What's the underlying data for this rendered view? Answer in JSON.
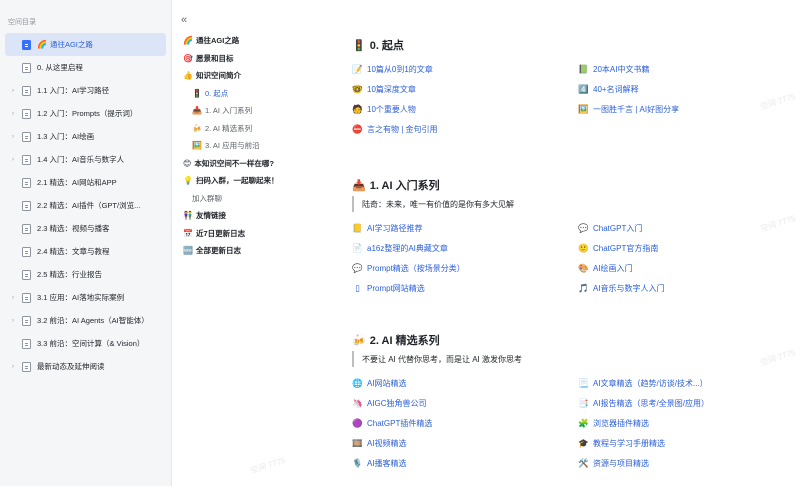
{
  "sidebar": {
    "title": "空间目录",
    "items": [
      {
        "arrow": "",
        "emoji": "🌈",
        "label": "通往AGI之路",
        "active": true
      },
      {
        "arrow": "",
        "emoji": "",
        "label": "0. 从这里启程"
      },
      {
        "arrow": "›",
        "emoji": "",
        "label": "1.1 入门：AI学习路径"
      },
      {
        "arrow": "›",
        "emoji": "",
        "label": "1.2 入门：Prompts（提示词）"
      },
      {
        "arrow": "›",
        "emoji": "",
        "label": "1.3 入门：AI绘画"
      },
      {
        "arrow": "›",
        "emoji": "",
        "label": "1.4 入门：AI音乐与数字人"
      },
      {
        "arrow": "",
        "emoji": "",
        "label": "2.1 精选：AI网站和APP"
      },
      {
        "arrow": "",
        "emoji": "",
        "label": "2.2 精选：AI插件（GPT/浏览..."
      },
      {
        "arrow": "",
        "emoji": "",
        "label": "2.3 精选：视频与播客"
      },
      {
        "arrow": "",
        "emoji": "",
        "label": "2.4 精选：文章与教程"
      },
      {
        "arrow": "",
        "emoji": "",
        "label": "2.5 精选：行业报告"
      },
      {
        "arrow": "›",
        "emoji": "",
        "label": "3.1 应用：AI落地实际案例"
      },
      {
        "arrow": "›",
        "emoji": "",
        "label": "3.2 前沿：AI Agents（AI智能体）"
      },
      {
        "arrow": "",
        "emoji": "",
        "label": "3.3 前沿：空间计算（& Vision）"
      },
      {
        "arrow": "›",
        "emoji": "",
        "label": "最新动态及延伸阅读"
      }
    ]
  },
  "outline": {
    "collapse_icon": "«",
    "items": [
      {
        "level": "l1",
        "emoji": "🌈",
        "label": "通往AGI之路"
      },
      {
        "level": "l1",
        "emoji": "🎯",
        "label": "愿景和目标"
      },
      {
        "level": "l1",
        "emoji": "👍",
        "label": "知识空间简介"
      },
      {
        "level": "l3",
        "emoji": "🚦",
        "label": "0. 起点",
        "current": true
      },
      {
        "level": "l3",
        "emoji": "📥",
        "label": "1. AI 入门系列"
      },
      {
        "level": "l3",
        "emoji": "🍻",
        "label": "2. AI 精选系列"
      },
      {
        "level": "l3",
        "emoji": "🖼️",
        "label": "3. AI 应用与前沿"
      },
      {
        "level": "l1",
        "emoji": "😊",
        "label": "本知识空间不一样在哪?"
      },
      {
        "level": "l1",
        "emoji": "💡",
        "label": "扫码入群，一起聊起来！"
      },
      {
        "level": "l2b",
        "emoji": "",
        "label": "加入群聊"
      },
      {
        "level": "l1",
        "emoji": "👫",
        "label": "友情链接"
      },
      {
        "level": "l1",
        "emoji": "📅",
        "label": "近7日更新日志"
      },
      {
        "level": "l1",
        "emoji": "🆕",
        "label": "全部更新日志"
      }
    ]
  },
  "main": {
    "sections": [
      {
        "title": "0. 起点",
        "emoji": "🚦",
        "quote": "",
        "left": [
          {
            "emoji": "📝",
            "label": "10篇从0到1的文章"
          },
          {
            "emoji": "🤓",
            "label": "10篇深度文章"
          },
          {
            "emoji": "🧑",
            "label": "10个重要人物"
          },
          {
            "emoji": "⛔",
            "label": "言之有物 | 金句引用"
          }
        ],
        "right": [
          {
            "emoji": "📗",
            "label": "20本AI中文书籍"
          },
          {
            "emoji": "4️⃣",
            "label": "40+名词解释"
          },
          {
            "emoji": "🖼️",
            "label": "一图胜千言 | AI好图分享"
          }
        ]
      },
      {
        "title": "1. AI 入门系列",
        "emoji": "📥",
        "quote": "陆奇：未来，唯一有价值的是你有多大见解",
        "left": [
          {
            "emoji": "📒",
            "label": "AI学习路径推荐"
          },
          {
            "emoji": "📄",
            "label": "a16z整理的AI典藏文章"
          },
          {
            "emoji": "💬",
            "label": "Prompt精选（按场景分类）"
          },
          {
            "emoji": "▯",
            "label": "Prompt网站精选"
          }
        ],
        "right": [
          {
            "emoji": "💬",
            "label": "ChatGPT入门"
          },
          {
            "emoji": "🙂",
            "label": "ChatGPT官方指南"
          },
          {
            "emoji": "🎨",
            "label": "AI绘画入门"
          },
          {
            "emoji": "🎵",
            "label": "AI音乐与数字人入门"
          }
        ]
      },
      {
        "title": "2. AI 精选系列",
        "emoji": "🍻",
        "quote": "不要让 AI 代替你思考，而是让 AI 激发你思考",
        "left": [
          {
            "emoji": "🌐",
            "label": "AI网站精选"
          },
          {
            "emoji": "🦄",
            "label": "AIGC独角兽公司"
          },
          {
            "emoji": "🟣",
            "label": "ChatGPT插件精选"
          },
          {
            "emoji": "🎞️",
            "label": "AI视频精选"
          },
          {
            "emoji": "🎙️",
            "label": "AI播客精选"
          }
        ],
        "right": [
          {
            "emoji": "📃",
            "label": "AI文章精选（趋势/访谈/技术...）"
          },
          {
            "emoji": "📑",
            "label": "AI报告精选（思考/全景图/应用）"
          },
          {
            "emoji": "🧩",
            "label": "浏览器插件精选"
          },
          {
            "emoji": "🎓",
            "label": "教程与学习手册精选"
          },
          {
            "emoji": "🛠️",
            "label": "资源与项目精选"
          }
        ]
      }
    ]
  }
}
